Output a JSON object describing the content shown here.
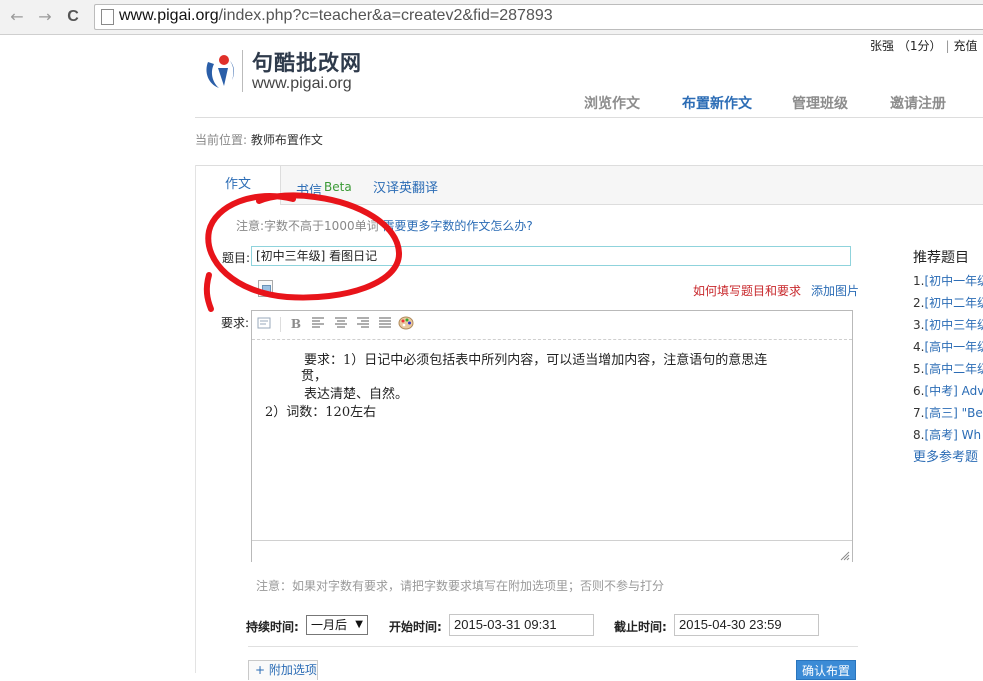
{
  "browser": {
    "url_host": "www.pigai.org",
    "url_path": "/index.php?c=teacher&a=createv2&fid=287893",
    "back_glyph": "←",
    "forward_glyph": "→",
    "reload_glyph": "C"
  },
  "header": {
    "logo_title": "句酷批改网",
    "logo_url": "www.pigai.org",
    "user_name": "张强",
    "user_points": "（1分）",
    "recharge": "充值",
    "bar": "|"
  },
  "nav": {
    "items": [
      "浏览作文",
      "布置新作文",
      "管理班级",
      "邀请注册"
    ],
    "active_index": 1
  },
  "breadcrumb": {
    "label": "当前位置:",
    "current": "教师布置作文"
  },
  "tabs": {
    "essay": "作文",
    "letter": "书信",
    "letter_badge": "Beta",
    "translate": "汉译英翻译"
  },
  "form": {
    "notice_prefix": "注意:字数不高于1000单词",
    "notice_link": "需要更多字数的作文怎么办?",
    "title_label": "题目:",
    "title_value": "[初中三年级] 看图日记",
    "howto_link": "如何填写题目和要求",
    "add_image_link": "添加图片",
    "req_label": "要求:",
    "toolbar": {
      "bold": "B"
    },
    "editor_lines": [
      "要求：1）日记中必须包括表中所列内容，可以适当增加内容，注意语句的意思连",
      "贯，",
      "表达清楚、自然。",
      "2）词数：120左右"
    ],
    "word_note": "注意：如果对字数有要求，请把字数要求填写在附加选项里；否则不参与打分",
    "duration_label": "持续时间:",
    "duration_value": "一月后",
    "duration_arrow": "▼",
    "start_label": "开始时间:",
    "start_value": "2015-03-31 09:31",
    "end_label": "截止时间:",
    "end_value": "2015-04-30 23:59",
    "extra_options": "+ 附加选项",
    "confirm": "确认布置"
  },
  "recommend": {
    "title": "推荐题目",
    "items": [
      {
        "num": "1.",
        "text": "[初中一年级"
      },
      {
        "num": "2.",
        "text": "[初中二年级"
      },
      {
        "num": "3.",
        "text": "[初中三年级"
      },
      {
        "num": "4.",
        "text": "[高中一年级"
      },
      {
        "num": "5.",
        "text": "[高中二年级"
      },
      {
        "num": "6.",
        "text": "[中考] Adv"
      },
      {
        "num": "7.",
        "text": "[高三] \"Be"
      },
      {
        "num": "8.",
        "text": "[高考] Wh"
      }
    ],
    "more": "更多参考题"
  },
  "colors": {
    "link_blue": "#2b6cb5",
    "annotation_red": "#e8141a",
    "warning_red": "#c8282c",
    "beta_green": "#3a9a35"
  }
}
